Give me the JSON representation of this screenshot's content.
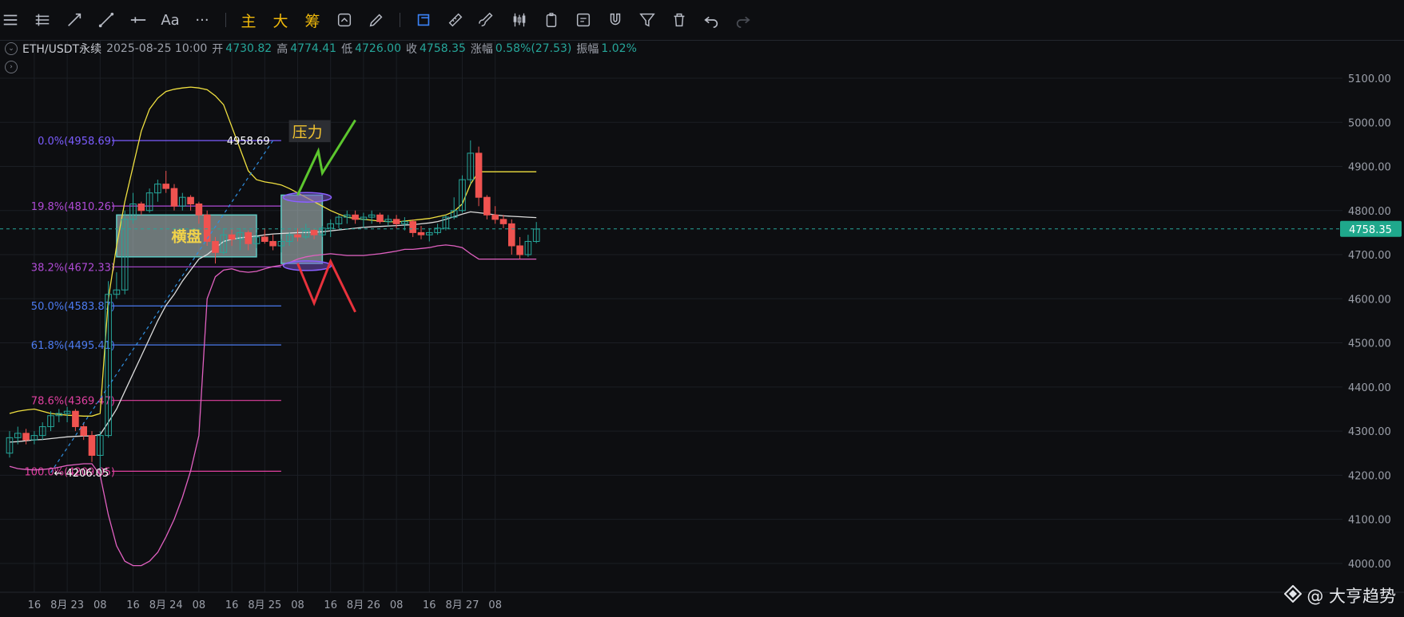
{
  "toolbar": {
    "items": [
      {
        "name": "menu-icon",
        "glyph": "menu"
      },
      {
        "name": "horizontal-lines-icon",
        "glyph": "hlines"
      },
      {
        "name": "ray-line-icon",
        "glyph": "ray"
      },
      {
        "name": "trend-line-icon",
        "glyph": "trend"
      },
      {
        "name": "horizontal-ray-icon",
        "glyph": "hray"
      },
      {
        "name": "text-tool-icon",
        "text": "Aa"
      },
      {
        "name": "more-icon",
        "text": "···"
      },
      {
        "name": "main-indicator-button",
        "text": "主"
      },
      {
        "name": "big-button",
        "text": "大"
      },
      {
        "name": "chips-button",
        "text": "筹"
      },
      {
        "name": "refresh-icon",
        "glyph": "refresh"
      },
      {
        "name": "pen-icon",
        "glyph": "pen"
      },
      {
        "name": "draw-mode-icon",
        "glyph": "draw"
      },
      {
        "name": "ruler-icon",
        "glyph": "ruler"
      },
      {
        "name": "brush-icon",
        "glyph": "brush"
      },
      {
        "name": "candlestick-icon",
        "glyph": "candle"
      },
      {
        "name": "clipboard-icon",
        "glyph": "clip"
      },
      {
        "name": "edit-icon",
        "glyph": "edit"
      },
      {
        "name": "magnet-icon",
        "glyph": "magnet"
      },
      {
        "name": "filter-icon",
        "glyph": "filter"
      },
      {
        "name": "trash-icon",
        "glyph": "trash"
      },
      {
        "name": "undo-icon",
        "glyph": "undo"
      },
      {
        "name": "redo-icon",
        "glyph": "redo"
      }
    ]
  },
  "ohlc": {
    "symbol": "ETH/USDT永续",
    "datetime": "2025-08-25 10:00",
    "open_label": "开",
    "open": "4730.82",
    "high_label": "高",
    "high": "4774.41",
    "low_label": "低",
    "low": "4726.00",
    "close_label": "收",
    "close": "4758.35",
    "change_label": "涨幅",
    "change": "0.58%(27.53)",
    "amp_label": "振幅",
    "amp": "1.02%"
  },
  "watermark": "@ 大亨趋势",
  "colors": {
    "up": "#26a69a",
    "down": "#ef5350",
    "background": "#0d0e11"
  },
  "chart_data": {
    "type": "candlestick",
    "title": "",
    "interval_hours": 2,
    "start": "2025-08-22 10:00",
    "ylim": [
      3950,
      5150
    ],
    "y_ticks": [
      4000,
      4100,
      4200,
      4300,
      4400,
      4500,
      4600,
      4700,
      4800,
      4900,
      5000,
      5100
    ],
    "y_tick_labels": [
      "4000.00",
      "4100.00",
      "4200.00",
      "4300.00",
      "4400.00",
      "4500.00",
      "4600.00",
      "4700.00",
      "4800.00",
      "4900.00",
      "5000.00",
      "5100.00"
    ],
    "x_ticks": [
      {
        "label": "16",
        "t": "2025-08-22 16:00"
      },
      {
        "label": "8月 23",
        "t": "2025-08-23 00:00"
      },
      {
        "label": "08",
        "t": "2025-08-23 08:00"
      },
      {
        "label": "16",
        "t": "2025-08-23 16:00"
      },
      {
        "label": "8月 24",
        "t": "2025-08-24 00:00"
      },
      {
        "label": "08",
        "t": "2025-08-24 08:00"
      },
      {
        "label": "16",
        "t": "2025-08-24 16:00"
      },
      {
        "label": "8月 25",
        "t": "2025-08-25 00:00"
      },
      {
        "label": "08",
        "t": "2025-08-25 08:00"
      },
      {
        "label": "16",
        "t": "2025-08-25 16:00"
      },
      {
        "label": "8月 26",
        "t": "2025-08-26 00:00"
      },
      {
        "label": "08",
        "t": "2025-08-26 08:00"
      },
      {
        "label": "16",
        "t": "2025-08-26 16:00"
      },
      {
        "label": "8月 27",
        "t": "2025-08-27 00:00"
      },
      {
        "label": "08",
        "t": "2025-08-27 08:00"
      }
    ],
    "current_price": "4758.35",
    "ohlc": [
      [
        4250,
        4300,
        4240,
        4285
      ],
      [
        4285,
        4310,
        4270,
        4295
      ],
      [
        4295,
        4305,
        4270,
        4280
      ],
      [
        4280,
        4300,
        4270,
        4290
      ],
      [
        4290,
        4320,
        4280,
        4310
      ],
      [
        4310,
        4345,
        4300,
        4335
      ],
      [
        4335,
        4350,
        4320,
        4340
      ],
      [
        4340,
        4355,
        4320,
        4345
      ],
      [
        4345,
        4350,
        4300,
        4310
      ],
      [
        4310,
        4320,
        4280,
        4290
      ],
      [
        4290,
        4300,
        4230,
        4245
      ],
      [
        4245,
        4300,
        4210,
        4290
      ],
      [
        4290,
        4640,
        4285,
        4610
      ],
      [
        4610,
        4660,
        4600,
        4620
      ],
      [
        4620,
        4800,
        4610,
        4780
      ],
      [
        4780,
        4840,
        4770,
        4815
      ],
      [
        4815,
        4820,
        4790,
        4800
      ],
      [
        4800,
        4850,
        4795,
        4840
      ],
      [
        4840,
        4870,
        4820,
        4860
      ],
      [
        4860,
        4890,
        4840,
        4850
      ],
      [
        4850,
        4860,
        4800,
        4810
      ],
      [
        4810,
        4840,
        4800,
        4830
      ],
      [
        4830,
        4835,
        4800,
        4815
      ],
      [
        4815,
        4820,
        4770,
        4790
      ],
      [
        4790,
        4800,
        4720,
        4730
      ],
      [
        4730,
        4740,
        4680,
        4705
      ],
      [
        4705,
        4760,
        4700,
        4745
      ],
      [
        4745,
        4760,
        4720,
        4735
      ],
      [
        4735,
        4760,
        4710,
        4750
      ],
      [
        4750,
        4755,
        4710,
        4725
      ],
      [
        4725,
        4750,
        4715,
        4740
      ],
      [
        4740,
        4760,
        4725,
        4730
      ],
      [
        4730,
        4745,
        4710,
        4720
      ],
      [
        4720,
        4735,
        4705,
        4730
      ],
      [
        4730,
        4750,
        4720,
        4745
      ],
      [
        4745,
        4760,
        4730,
        4740
      ],
      [
        4740,
        4770,
        4735,
        4755
      ],
      [
        4755,
        4760,
        4735,
        4745
      ],
      [
        4745,
        4765,
        4740,
        4760
      ],
      [
        4760,
        4780,
        4740,
        4770
      ],
      [
        4770,
        4790,
        4760,
        4785
      ],
      [
        4785,
        4800,
        4770,
        4790
      ],
      [
        4790,
        4800,
        4770,
        4780
      ],
      [
        4780,
        4795,
        4760,
        4785
      ],
      [
        4785,
        4800,
        4770,
        4790
      ],
      [
        4790,
        4795,
        4770,
        4775
      ],
      [
        4775,
        4790,
        4765,
        4780
      ],
      [
        4780,
        4790,
        4760,
        4770
      ],
      [
        4770,
        4785,
        4755,
        4775
      ],
      [
        4775,
        4780,
        4740,
        4750
      ],
      [
        4750,
        4765,
        4735,
        4745
      ],
      [
        4745,
        4760,
        4730,
        4750
      ],
      [
        4750,
        4770,
        4745,
        4760
      ],
      [
        4760,
        4790,
        4755,
        4785
      ],
      [
        4785,
        4830,
        4780,
        4800
      ],
      [
        4800,
        4880,
        4795,
        4870
      ],
      [
        4870,
        4959,
        4860,
        4930
      ],
      [
        4930,
        4945,
        4810,
        4830
      ],
      [
        4830,
        4835,
        4780,
        4790
      ],
      [
        4790,
        4810,
        4770,
        4780
      ],
      [
        4780,
        4790,
        4760,
        4770
      ],
      [
        4770,
        4780,
        4700,
        4720
      ],
      [
        4720,
        4740,
        4690,
        4700
      ],
      [
        4700,
        4745,
        4695,
        4730
      ],
      [
        4730,
        4774,
        4726,
        4758
      ]
    ],
    "bollinger": {
      "upper": [
        4340,
        4345,
        4348,
        4350,
        4345,
        4340,
        4338,
        4336,
        4335,
        4334,
        4334,
        4340,
        4600,
        4720,
        4820,
        4900,
        4980,
        5030,
        5055,
        5070,
        5075,
        5078,
        5080,
        5078,
        5074,
        5060,
        5040,
        4990,
        4940,
        4890,
        4870,
        4865,
        4862,
        4858,
        4850,
        4840,
        4830,
        4820,
        4810,
        4800,
        4792,
        4785,
        4782,
        4780,
        4778,
        4776,
        4775,
        4774,
        4776,
        4778,
        4780,
        4782,
        4786,
        4790,
        4798,
        4815,
        4860,
        4888,
        4888,
        4888,
        4888,
        4888,
        4888,
        4888,
        4888
      ],
      "middle": [
        4275,
        4276,
        4278,
        4280,
        4281,
        4283,
        4285,
        4287,
        4288,
        4289,
        4289,
        4292,
        4320,
        4350,
        4390,
        4430,
        4470,
        4510,
        4550,
        4585,
        4610,
        4640,
        4665,
        4690,
        4700,
        4715,
        4730,
        4735,
        4738,
        4740,
        4742,
        4745,
        4747,
        4748,
        4749,
        4750,
        4750,
        4751,
        4752,
        4754,
        4756,
        4758,
        4760,
        4762,
        4763,
        4764,
        4765,
        4766,
        4767,
        4768,
        4770,
        4772,
        4775,
        4780,
        4786,
        4792,
        4797,
        4795,
        4793,
        4790,
        4788,
        4787,
        4786,
        4785,
        4784
      ],
      "lower": [
        4220,
        4215,
        4213,
        4212,
        4213,
        4215,
        4218,
        4222,
        4224,
        4226,
        4226,
        4200,
        4110,
        4040,
        4005,
        3995,
        3995,
        4005,
        4025,
        4060,
        4100,
        4150,
        4210,
        4290,
        4600,
        4650,
        4665,
        4668,
        4662,
        4660,
        4662,
        4668,
        4673,
        4676,
        4682,
        4690,
        4695,
        4698,
        4700,
        4702,
        4700,
        4698,
        4698,
        4698,
        4700,
        4702,
        4705,
        4708,
        4712,
        4712,
        4714,
        4716,
        4720,
        4722,
        4720,
        4716,
        4702,
        4690,
        4690,
        4690,
        4690,
        4690,
        4690,
        4690,
        4690
      ]
    },
    "fibonacci": [
      {
        "label": "0.0%(4958.69)",
        "price": 4958.69,
        "color": "#7b5cff"
      },
      {
        "label": "19.8%(4810.26)",
        "price": 4810.26,
        "color": "#b04bd6"
      },
      {
        "label": "38.2%(4672.33)",
        "price": 4672.33,
        "color": "#b04bd6"
      },
      {
        "label": "50.0%(4583.87)",
        "price": 4583.87,
        "color": "#4c7bf0"
      },
      {
        "label": "61.8%(4495.41)",
        "price": 4495.41,
        "color": "#4c7bf0"
      },
      {
        "label": "78.6%(4369.47)",
        "price": 4369.47,
        "color": "#e040a0"
      },
      {
        "label": "100.0%(4209.05)",
        "price": 4209.05,
        "color": "#e040a0"
      }
    ],
    "fib_start": "2025-08-22 10:00",
    "fib_end": "2025-08-25 04:00",
    "trend_from": {
      "t": "2025-08-22 20:00",
      "price": 4206.05,
      "label": "4206.05"
    },
    "trend_to": {
      "t": "2025-08-25 02:00",
      "price": 4958.69,
      "label": "4958.69"
    },
    "ranges": [
      {
        "label": "横盘",
        "t_from": "2025-08-23 12:00",
        "t_to": "2025-08-24 22:00",
        "p_from": 4695,
        "p_to": 4790
      },
      {
        "label": "",
        "t_from": "2025-08-25 04:00",
        "t_to": "2025-08-25 14:00",
        "p_from": 4680,
        "p_to": 4835
      }
    ],
    "pressure_label": {
      "text": "压力",
      "t_from": "2025-08-25 02:00",
      "t_to": "2025-08-25 16:00",
      "p_from": 4955,
      "p_to": 5005
    },
    "ellipses": [
      {
        "t": "2025-08-25 08:00",
        "price": 4830
      },
      {
        "t": "2025-08-25 08:00",
        "price": 4675
      }
    ],
    "bull_path": [
      {
        "t": "2025-08-25 08:00",
        "price": 4835
      },
      {
        "t": "2025-08-25 13:00",
        "price": 4935
      },
      {
        "t": "2025-08-25 14:00",
        "price": 4885
      },
      {
        "t": "2025-08-25 22:00",
        "price": 5005
      }
    ],
    "bear_path": [
      {
        "t": "2025-08-25 08:00",
        "price": 4680
      },
      {
        "t": "2025-08-25 12:00",
        "price": 4590
      },
      {
        "t": "2025-08-25 16:00",
        "price": 4685
      },
      {
        "t": "2025-08-25 22:00",
        "price": 4570
      }
    ]
  }
}
